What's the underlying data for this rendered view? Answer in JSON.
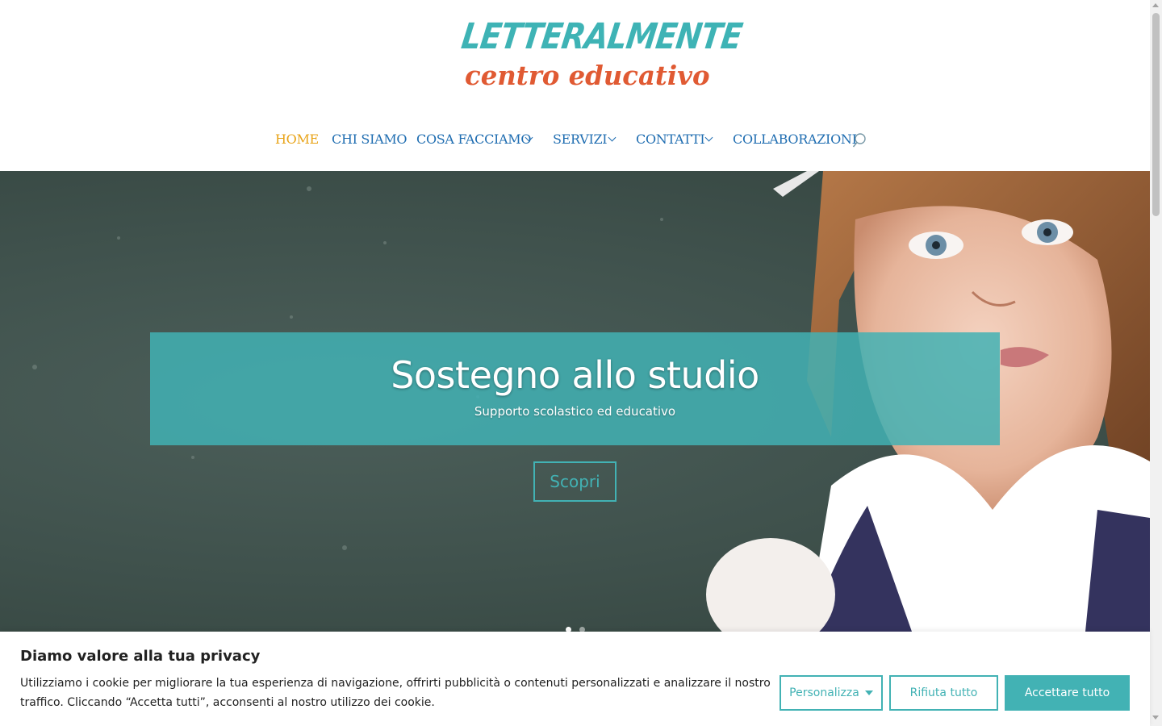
{
  "logo": {
    "line1": "LETTERALMENTE",
    "line2": "centro educativo"
  },
  "nav": {
    "items": [
      {
        "label": "HOME",
        "active": true,
        "dropdown": false
      },
      {
        "label": "CHI SIAMO",
        "active": false,
        "dropdown": false
      },
      {
        "label": "COSA FACCIAMO",
        "active": false,
        "dropdown": true
      },
      {
        "label": "SERVIZI",
        "active": false,
        "dropdown": true
      },
      {
        "label": "CONTATTI",
        "active": false,
        "dropdown": true
      },
      {
        "label": "COLLABORAZIONI",
        "active": false,
        "dropdown": false
      }
    ],
    "search_icon": "search-icon"
  },
  "hero": {
    "title": "Sostegno allo studio",
    "subtitle": "Supporto scolastico ed educativo",
    "button_label": "Scopri",
    "slides": 2,
    "active_slide": 1
  },
  "cookie": {
    "title": "Diamo valore alla tua privacy",
    "text": "Utilizziamo i cookie per migliorare la tua esperienza di navigazione, offrirti pubblicità o contenuti personalizzati e analizzare il nostro traffico. Cliccando “Accetta tutti”, acconsenti al nostro utilizzo dei cookie.",
    "customize_label": "Personalizza",
    "reject_label": "Rifiuta tutto",
    "accept_label": "Accettare tutto"
  },
  "colors": {
    "accent": "#42b2b4",
    "nav_link": "#1f6db1",
    "nav_active": "#e8a317",
    "logo_teal": "#3eb3b5",
    "logo_orange": "#e05a33"
  }
}
